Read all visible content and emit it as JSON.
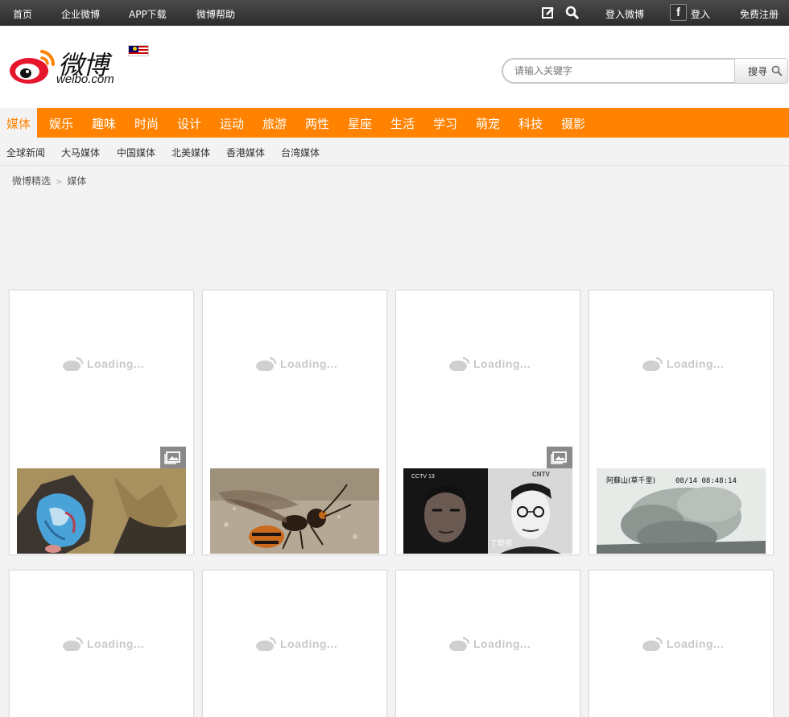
{
  "topbar": {
    "links": [
      "首页",
      "企业微博",
      "APP下载",
      "微博帮助"
    ],
    "login_weibo": "登入微博",
    "fb_letter": "f",
    "login": "登入",
    "register": "免费注册"
  },
  "header": {
    "logo_cn": "微博",
    "logo_en": "weibo.com",
    "search_placeholder": "请输入关键字",
    "search_button": "搜寻"
  },
  "nav": {
    "items": [
      "媒体",
      "娱乐",
      "趣味",
      "时尚",
      "设计",
      "运动",
      "旅游",
      "两性",
      "星座",
      "生活",
      "学习",
      "萌宠",
      "科技",
      "摄影"
    ],
    "active_index": 0
  },
  "subnav": {
    "items": [
      "全球新闻",
      "大马媒体",
      "中国媒体",
      "北美媒体",
      "香港媒体",
      "台湾媒体"
    ]
  },
  "breadcrumb": {
    "root": "微博精选",
    "separator": ">",
    "current": "媒体"
  },
  "cards": {
    "loading_text": "Loading...",
    "row1": [
      {
        "photo": "blue-painted-rock-on-dry-grass",
        "gallery": true
      },
      {
        "photo": "hornet-on-sand",
        "gallery": false
      },
      {
        "photo": "cctv-split-portraits",
        "gallery": true,
        "caption_left": "CCTV 13",
        "caption_right": "CNTV",
        "name": "丁默邨"
      },
      {
        "photo": "volcano-eruption-camera",
        "gallery": false,
        "cam_label": "阿蘇山(草千里)",
        "cam_time": "08/14 08:48:14"
      }
    ]
  },
  "colors": {
    "accent": "#ff8200",
    "topbar": "#333333",
    "background": "#f3f3f3"
  },
  "icons": [
    "edit-icon",
    "search-icon",
    "facebook-icon",
    "weibo-eye-logo-icon",
    "malaysia-flag-icon",
    "gallery-icon",
    "loading-weibo-icon"
  ]
}
